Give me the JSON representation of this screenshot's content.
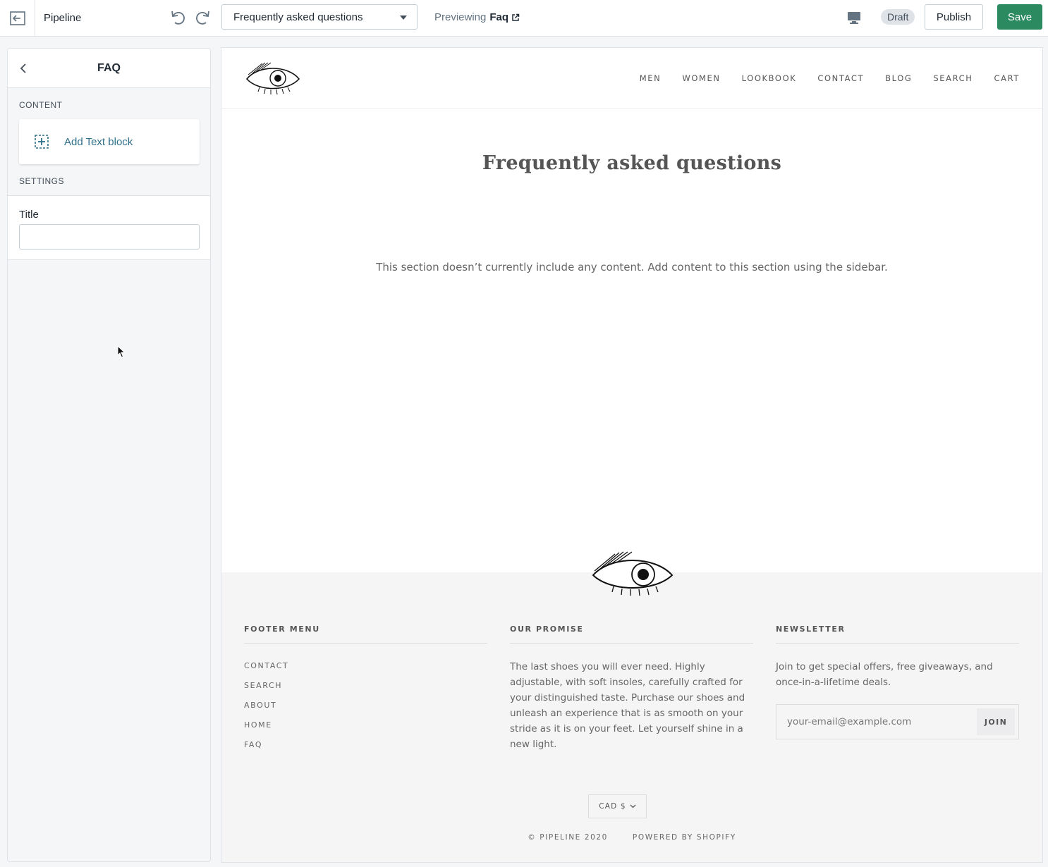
{
  "topbar": {
    "store_name": "Pipeline",
    "template_select": "Frequently asked questions",
    "previewing_label": "Previewing",
    "previewing_page": "Faq",
    "status_badge": "Draft",
    "publish_label": "Publish",
    "save_label": "Save",
    "accent_color": "#2c8a61"
  },
  "sidebar": {
    "title": "FAQ",
    "content_label": "CONTENT",
    "add_block_label": "Add Text block",
    "settings_label": "SETTINGS",
    "title_field_label": "Title",
    "title_field_value": ""
  },
  "preview": {
    "nav": [
      "MEN",
      "WOMEN",
      "LOOKBOOK",
      "CONTACT",
      "BLOG",
      "SEARCH",
      "CART"
    ],
    "heading": "Frequently asked questions",
    "empty_note": "This section doesn’t currently include any content. Add content to this section using the sidebar.",
    "footer": {
      "menu_title": "FOOTER MENU",
      "menu_links": [
        "CONTACT",
        "SEARCH",
        "ABOUT",
        "HOME",
        "FAQ"
      ],
      "promise_title": "OUR PROMISE",
      "promise_text": "The last shoes you will ever need.  Highly adjustable, with soft insoles, carefully crafted for your distinguished taste.  Purchase our shoes and unleash an experience that is as smooth on your stride as it is on your feet.  Let yourself shine in a new light.",
      "newsletter_title": "NEWSLETTER",
      "newsletter_text": "Join to get special offers, free giveaways, and once-in-a-lifetime deals.",
      "email_placeholder": "your-email@example.com",
      "join_label": "JOIN",
      "currency": "CAD $",
      "copyright": "© PIPELINE 2020",
      "powered_by": "POWERED BY SHOPIFY"
    }
  }
}
